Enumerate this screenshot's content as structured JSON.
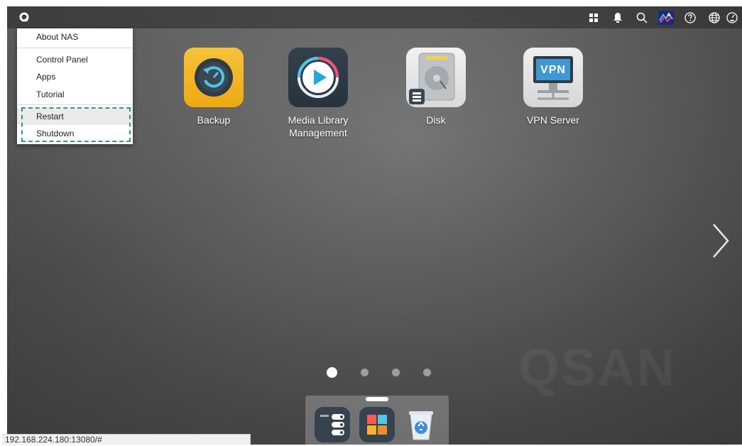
{
  "topbar": {
    "icons": [
      "logo-icon",
      "grid-icon",
      "bell-icon",
      "search-icon",
      "user-avatar-icon",
      "help-icon",
      "globe-icon",
      "dashboard-icon"
    ]
  },
  "start_menu": {
    "items": [
      {
        "label": "About NAS"
      },
      {
        "label": "Control Panel"
      },
      {
        "label": "Apps"
      },
      {
        "label": "Tutorial"
      },
      {
        "label": "Restart"
      },
      {
        "label": "Shutdown"
      }
    ],
    "highlight_color": "#3e8e87"
  },
  "apps": [
    {
      "name": "Backup",
      "label": "Backup",
      "icon": "backup-icon"
    },
    {
      "name": "Media Library Management",
      "label_line1": "Media Library",
      "label_line2": "Management",
      "icon": "play-icon"
    },
    {
      "name": "Disk",
      "label": "Disk",
      "icon": "disk-icon"
    },
    {
      "name": "VPN Server",
      "label": "VPN Server",
      "icon_text": "VPN",
      "icon": "vpn-icon"
    }
  ],
  "pager": {
    "pages": 4,
    "current": 1
  },
  "watermark": "QSAN",
  "dock": {
    "icons": [
      "storage-manager-icon",
      "app-center-icon",
      "recycle-bin-icon"
    ]
  },
  "statusbar": {
    "url": "192.168.224.180:13080/#"
  },
  "colors": {
    "accent": "#3e8e87",
    "backup_tile": "#f3b21b",
    "media_tile": "#2f3b45",
    "vpn_tile": "#e8e8e8"
  }
}
